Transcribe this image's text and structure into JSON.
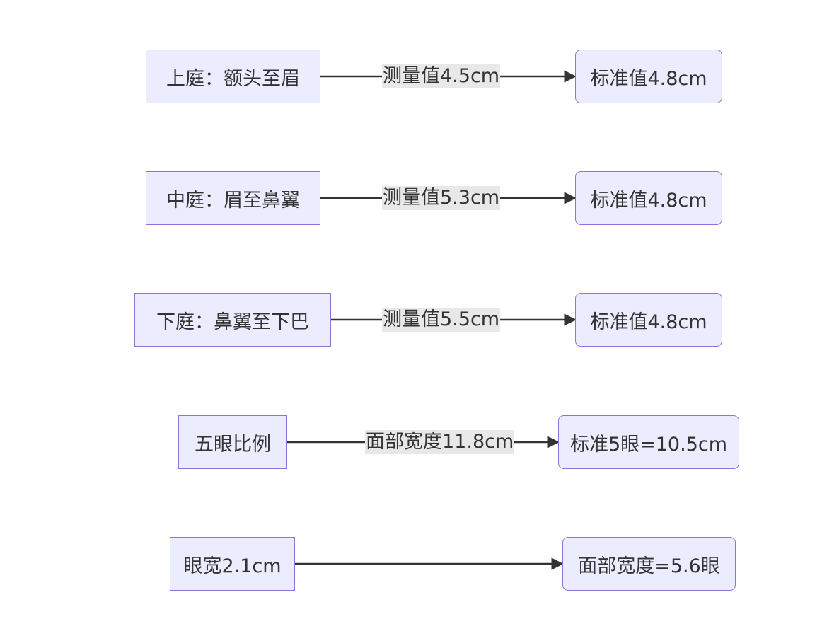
{
  "rows": [
    {
      "source": "上庭：额头至眉",
      "edge_label": "测量值4.5cm",
      "target": "标准值4.8cm"
    },
    {
      "source": "中庭：眉至鼻翼",
      "edge_label": "测量值5.3cm",
      "target": "标准值4.8cm"
    },
    {
      "source": "下庭：鼻翼至下巴",
      "edge_label": "测量值5.5cm",
      "target": "标准值4.8cm"
    },
    {
      "source": "五眼比例",
      "edge_label": "面部宽度11.8cm",
      "target": "标准5眼=10.5cm"
    },
    {
      "source": "眼宽2.1cm",
      "edge_label": "",
      "target": "面部宽度=5.6眼"
    }
  ],
  "colors": {
    "node_fill": "#ECECFF",
    "node_border": "#9370DB",
    "text": "#333333",
    "edge": "#333333",
    "label_bg": "#e8e8e8"
  }
}
